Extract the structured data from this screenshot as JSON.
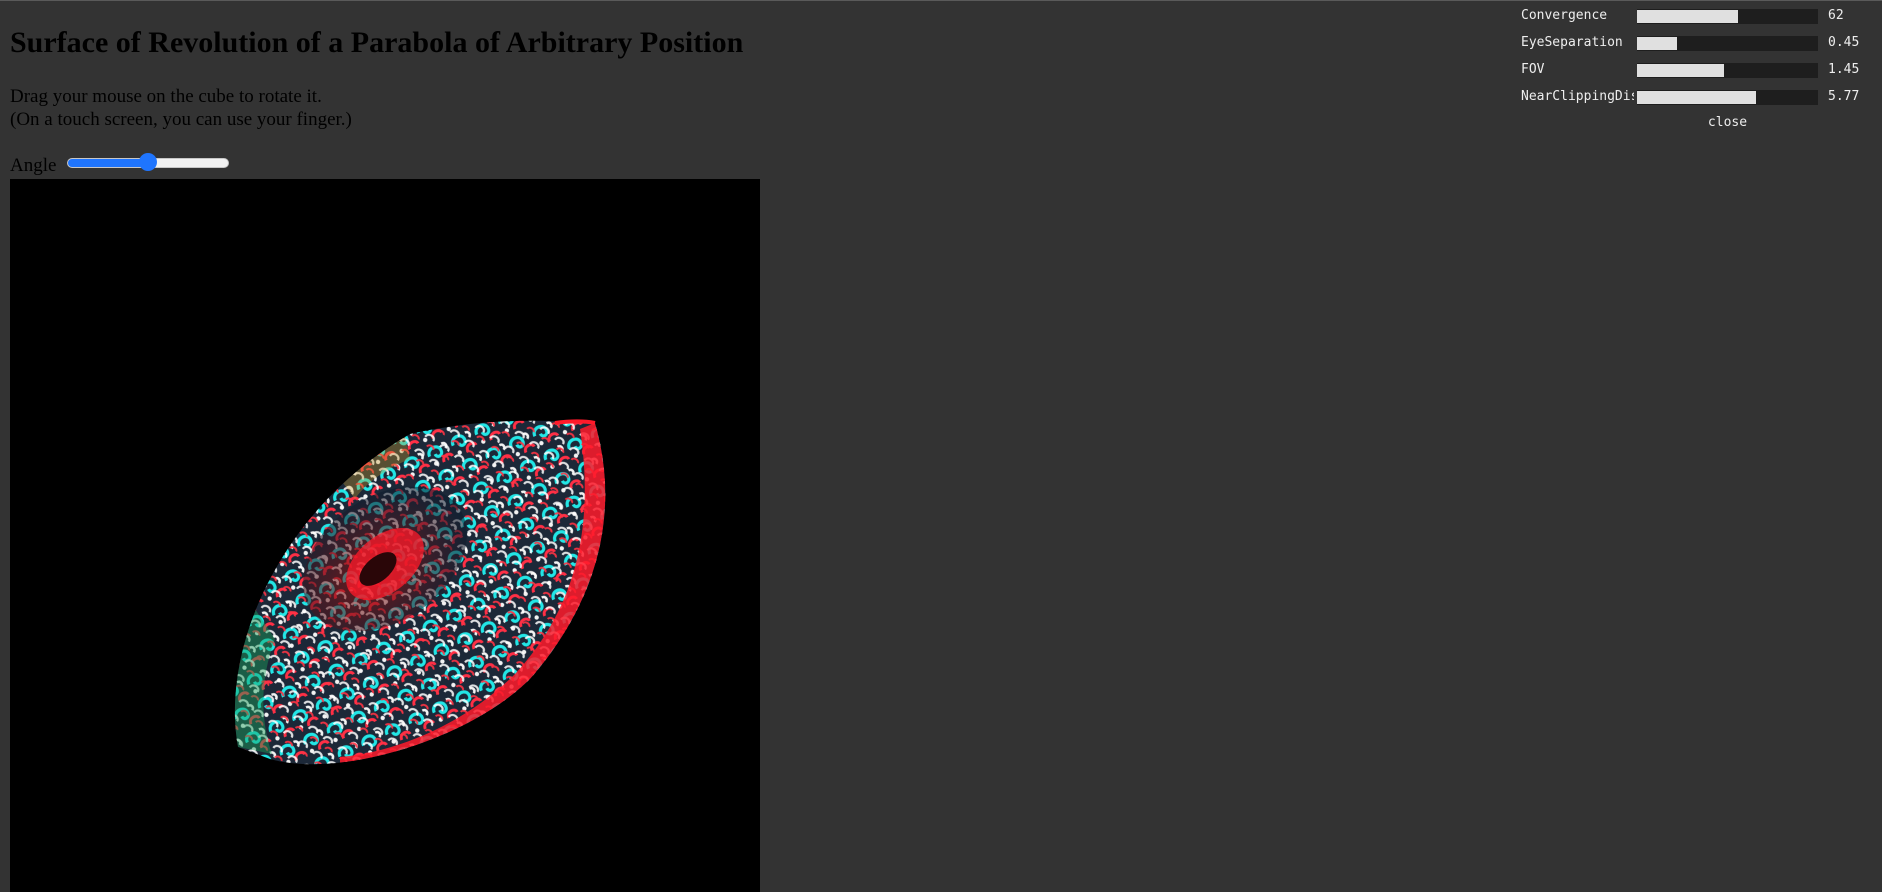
{
  "page": {
    "title": "Surface of Revolution of a Parabola of Arbitrary Position",
    "instructions": [
      "Drag your mouse on the cube to rotate it.",
      "(On a touch screen, you can use your finger.)"
    ]
  },
  "angle_control": {
    "label": "Angle",
    "value_fraction": 0.5
  },
  "colors": {
    "background": "#333333",
    "canvas": "#000000",
    "slider_accent": "#1f75fe",
    "anaglyph_red": "#ff1a2a",
    "anaglyph_cyan": "#22e6e6",
    "pattern_green": "#1aa05a"
  },
  "gui": {
    "controls": [
      {
        "label": "Convergence",
        "value": "62",
        "fill_fraction": 0.56
      },
      {
        "label": "EyeSeparation",
        "value": "0.45",
        "fill_fraction": 0.22
      },
      {
        "label": "FOV",
        "value": "1.45",
        "fill_fraction": 0.48
      },
      {
        "label": "NearClippingDistance",
        "value": "5.77",
        "fill_fraction": 0.66
      }
    ],
    "close_label": "close"
  }
}
